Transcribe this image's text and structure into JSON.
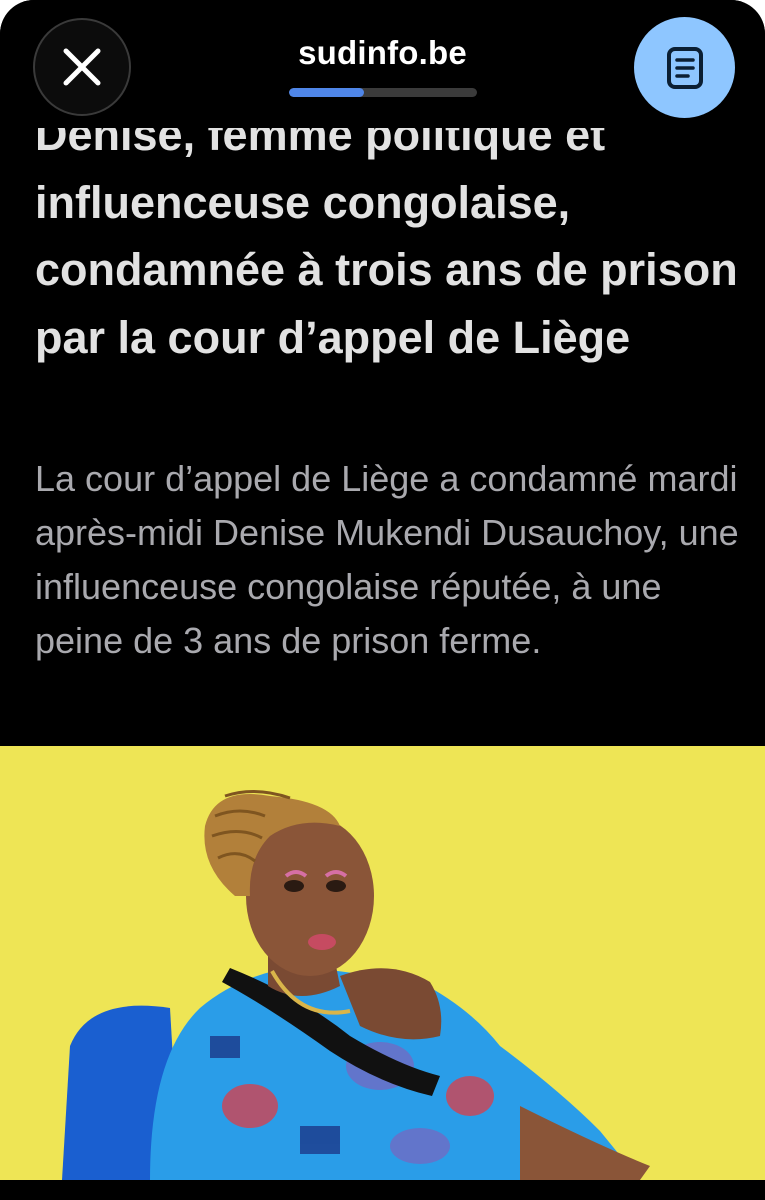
{
  "header": {
    "close_label": "Close",
    "site": "sudinfo.be",
    "reading_progress": 0.4,
    "reader_label": "Reader view"
  },
  "article": {
    "headline": "Denise, femme politique et influenceuse congolaise, condamnée à trois ans de prison par la cour d’appel de Liège",
    "standfirst": "La cour d’appel de Liège a condamné mardi après-midi Denise Mukendi Dusauchoy, une influenceuse congolaise réputée, à une peine de 3 ans de prison ferme."
  },
  "colors": {
    "background": "#000000",
    "accent": "#4f86e8",
    "reader_button": "#8ec6ff",
    "headline": "#e2e2e2",
    "standfirst": "#a9a9ae"
  },
  "icons": {
    "close": "close-icon",
    "reader": "reader-icon"
  }
}
